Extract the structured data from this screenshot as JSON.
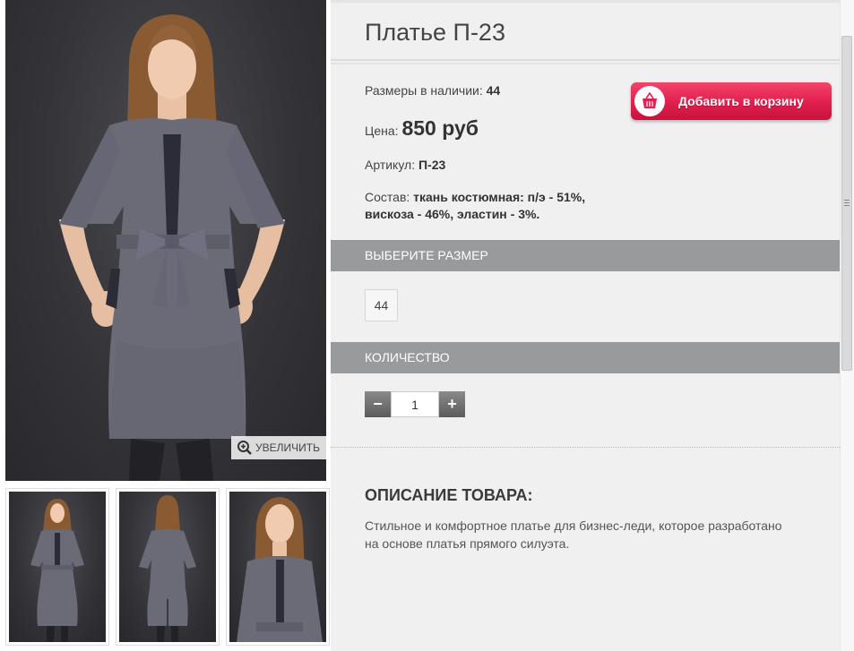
{
  "product": {
    "title": "Платье П-23",
    "sizes_label": "Размеры в наличии:",
    "sizes_value": "44",
    "price_label": "Цена:",
    "price_value": "850 руб",
    "article_label": "Артикул:",
    "article_value": "П-23",
    "composition_label": "Состав:",
    "composition_value": "ткань костюмная: п/э - 51%, вискоза - 46%, эластин - 3%."
  },
  "cart_button": {
    "label": "Добавить в корзину",
    "icon": "shopping-basket-icon"
  },
  "zoom_button": {
    "label": "УВЕЛИЧИТЬ",
    "icon": "zoom-in-icon"
  },
  "size_section": {
    "header": "ВЫБЕРИТЕ РАЗМЕР",
    "options": [
      "44"
    ]
  },
  "quantity_section": {
    "header": "КОЛИЧЕСТВО",
    "minus": "−",
    "plus": "+",
    "value": "1"
  },
  "description": {
    "title": "ОПИСАНИЕ ТОВАРА:",
    "text": "Стильное и комфортное платье для бизнес-леди, которое разработано на основе платья прямого силуэта."
  },
  "colors": {
    "panel_bg": "#f0f0f0",
    "section_bar": "#999a9c",
    "cart_button": "#e32150",
    "dress_gray": "#6b6b78"
  }
}
